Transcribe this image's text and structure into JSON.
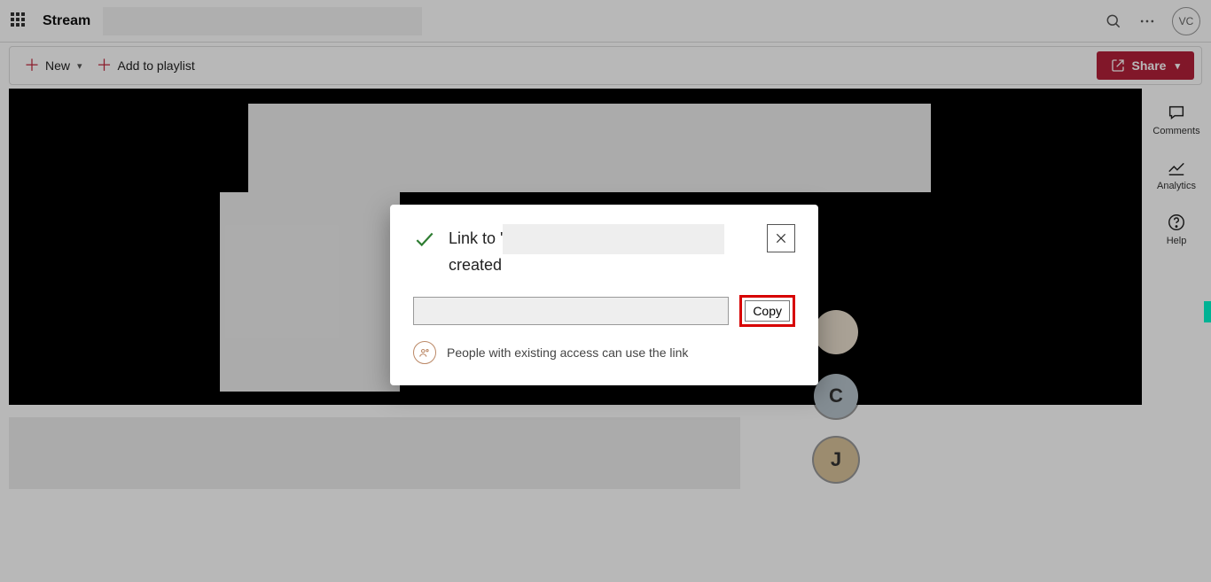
{
  "header": {
    "app_name": "Stream",
    "avatar_initials": "VC"
  },
  "toolbar": {
    "new_label": "New",
    "add_playlist_label": "Add to playlist",
    "share_label": "Share"
  },
  "rail": {
    "comments": "Comments",
    "analytics": "Analytics",
    "help": "Help"
  },
  "bubbles": [
    "",
    "C",
    "J"
  ],
  "dialog": {
    "msg_prefix": "Link to '",
    "msg_suffix": "created",
    "copy_label": "Copy",
    "permission_text": "People with existing access can use the link"
  }
}
